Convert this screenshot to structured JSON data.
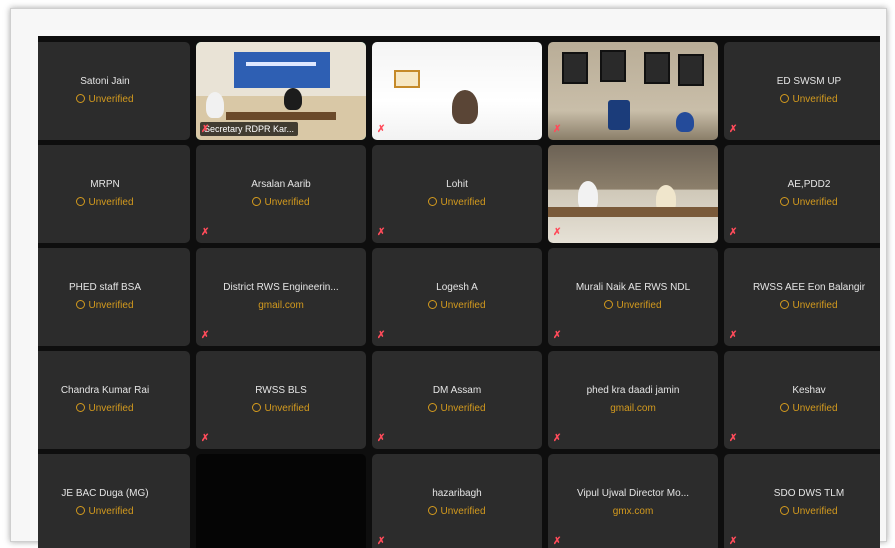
{
  "grid": {
    "tiles": [
      {
        "type": "name",
        "name": "Satoni Jain",
        "status": "Unverified",
        "status_kind": "unverified"
      },
      {
        "type": "video",
        "scene": "conf-room",
        "label": "Secretary RDPR Kar...",
        "active": true
      },
      {
        "type": "video",
        "scene": "office-white"
      },
      {
        "type": "video",
        "scene": "office-photos"
      },
      {
        "type": "name",
        "name": "ED SWSM UP",
        "status": "Unverified",
        "status_kind": "unverified"
      },
      {
        "type": "name",
        "name": "MRPN",
        "status": "Unverified",
        "status_kind": "unverified"
      },
      {
        "type": "name",
        "name": "Arsalan Aarib",
        "status": "Unverified",
        "status_kind": "unverified"
      },
      {
        "type": "name",
        "name": "Lohit",
        "status": "Unverified",
        "status_kind": "unverified"
      },
      {
        "type": "video",
        "scene": "meeting"
      },
      {
        "type": "name",
        "name": "AE,PDD2",
        "status": "Unverified",
        "status_kind": "unverified"
      },
      {
        "type": "name",
        "name": "PHED staff BSA",
        "status": "Unverified",
        "status_kind": "unverified"
      },
      {
        "type": "name",
        "name": "District RWS Engineerin...",
        "status": "gmail.com",
        "status_kind": "domain"
      },
      {
        "type": "name",
        "name": "Logesh A",
        "status": "Unverified",
        "status_kind": "unverified"
      },
      {
        "type": "name",
        "name": "Murali Naik AE RWS NDL",
        "status": "Unverified",
        "status_kind": "unverified"
      },
      {
        "type": "name",
        "name": "RWSS AEE Eon Balangir",
        "status": "Unverified",
        "status_kind": "unverified"
      },
      {
        "type": "name",
        "name": "Chandra Kumar Rai",
        "status": "Unverified",
        "status_kind": "unverified"
      },
      {
        "type": "name",
        "name": "RWSS BLS",
        "status": "Unverified",
        "status_kind": "unverified"
      },
      {
        "type": "name",
        "name": "DM Assam",
        "status": "Unverified",
        "status_kind": "unverified"
      },
      {
        "type": "name",
        "name": "phed kra daadi jamin",
        "status": "gmail.com",
        "status_kind": "domain"
      },
      {
        "type": "name",
        "name": "Keshav",
        "status": "Unverified",
        "status_kind": "unverified"
      },
      {
        "type": "name",
        "name": "JE BAC Duga (MG)",
        "status": "Unverified",
        "status_kind": "unverified"
      },
      {
        "type": "blank"
      },
      {
        "type": "name",
        "name": "hazaribagh",
        "status": "Unverified",
        "status_kind": "unverified"
      },
      {
        "type": "name",
        "name": "Vipul Ujwal Director Mo...",
        "status": "gmx.com",
        "status_kind": "domain"
      },
      {
        "type": "name",
        "name": "SDO DWS TLM",
        "status": "Unverified",
        "status_kind": "unverified"
      }
    ]
  },
  "icons": {
    "muted_mic": "mic-muted-icon",
    "unverified": "clock-icon"
  },
  "colors": {
    "tile_bg": "#2c2c2c",
    "stage_bg": "#0e0e0e",
    "unverified": "#d39a1e",
    "active_speaker": "#3fd7a3",
    "muted": "#ff4b5a"
  }
}
